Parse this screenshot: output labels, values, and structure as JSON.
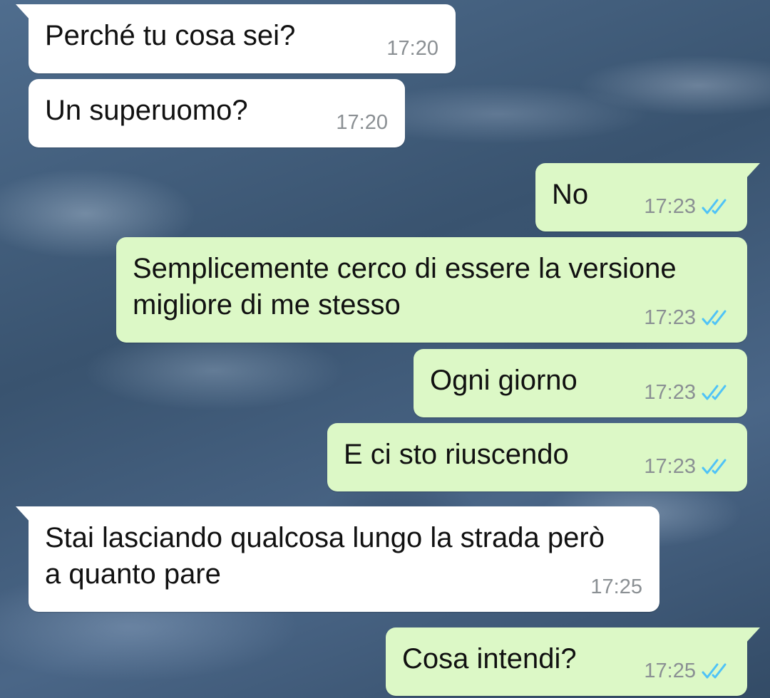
{
  "messages": [
    {
      "text": "Perché tu cosa sei?",
      "time": "17:20",
      "direction": "in"
    },
    {
      "text": "Un superuomo?",
      "time": "17:20",
      "direction": "in"
    },
    {
      "text": "No",
      "time": "17:23",
      "direction": "out",
      "status": "read"
    },
    {
      "text": "Semplicemente cerco di essere la versione migliore di me stesso",
      "time": "17:23",
      "direction": "out",
      "status": "read"
    },
    {
      "text": "Ogni giorno",
      "time": "17:23",
      "direction": "out",
      "status": "read"
    },
    {
      "text": "E ci sto riuscendo",
      "time": "17:23",
      "direction": "out",
      "status": "read"
    },
    {
      "text": "Stai lasciando qualcosa lungo la strada però a quanto pare",
      "time": "17:25",
      "direction": "in"
    },
    {
      "text": "Cosa intendi?",
      "time": "17:25",
      "direction": "out",
      "status": "read"
    }
  ],
  "colors": {
    "incoming_bubble": "#ffffff",
    "outgoing_bubble": "#dcf8c6",
    "read_tick": "#4fc3f7",
    "timestamp": "#8a8f93"
  },
  "icons": {
    "read_status": "double-check-icon"
  }
}
